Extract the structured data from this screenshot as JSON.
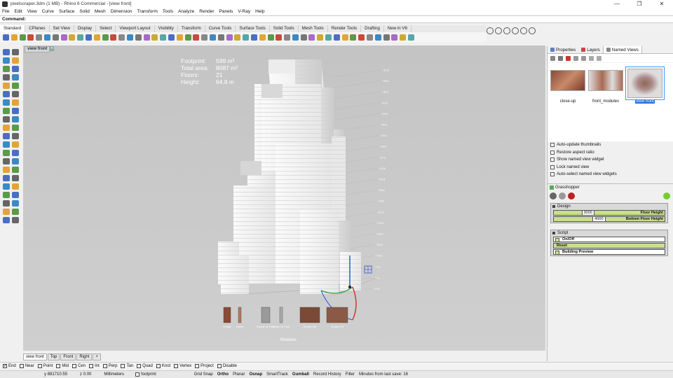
{
  "window": {
    "title": "pixelscraper.3dm (1 MB) - Rhino 6 Commercial - [view front]",
    "controls": [
      "—",
      "❐",
      "✕"
    ]
  },
  "menu": [
    "File",
    "Edit",
    "View",
    "Curve",
    "Surface",
    "Solid",
    "Mesh",
    "Dimension",
    "Transform",
    "Tools",
    "Analyze",
    "Render",
    "Panels",
    "V-Ray",
    "Help"
  ],
  "command": {
    "label": "Command:"
  },
  "toolbar_tabs": [
    "Standard",
    "CPlanes",
    "Set View",
    "Display",
    "Select",
    "Viewport Layout",
    "Visibility",
    "Transform",
    "Curve Tools",
    "Surface Tools",
    "Solid Tools",
    "Mesh Tools",
    "Render Tools",
    "Drafting",
    "New in V6"
  ],
  "viewport": {
    "label": "view front",
    "stats": [
      {
        "key": "Footprint:",
        "value": "599 m²"
      },
      {
        "key": "Total area:",
        "value": "8087 m²"
      },
      {
        "key": "Floors:",
        "value": "21"
      },
      {
        "key": "Height:",
        "value": "64.8 m"
      }
    ],
    "modules_label": "Modules",
    "module_names": [
      "Facade",
      "Corner",
      "Facade No Floor",
      "Corner No Floor",
      "Terrace 180",
      "Terrace 270"
    ],
    "level_labels": [
      "+61.8",
      "+58.8",
      "+55.8",
      "+52.8",
      "+49.8",
      "+46.8",
      "+43.8",
      "+40.8",
      "+37.8",
      "+34.8",
      "+31.8",
      "+28.8",
      "+25.8",
      "+22.8",
      "+19.8",
      "+16.8",
      "+13.8",
      "+10.8",
      "+7.8",
      "+4.8",
      "+1.8"
    ]
  },
  "viewport_tabs": [
    "view front",
    "Top",
    "Front",
    "Right",
    "+"
  ],
  "osnaps": [
    {
      "label": "End",
      "checked": true
    },
    {
      "label": "Near",
      "checked": false
    },
    {
      "label": "Point",
      "checked": false
    },
    {
      "label": "Mid",
      "checked": false
    },
    {
      "label": "Cen",
      "checked": false
    },
    {
      "label": "Int",
      "checked": false
    },
    {
      "label": "Perp",
      "checked": false
    },
    {
      "label": "Tan",
      "checked": false
    },
    {
      "label": "Quad",
      "checked": false
    },
    {
      "label": "Knot",
      "checked": false
    },
    {
      "label": "Vertex",
      "checked": false
    },
    {
      "label": "Project",
      "checked": false
    },
    {
      "label": "Disable",
      "checked": false
    }
  ],
  "status": {
    "coord": "y 881710.55",
    "z": "z 0.00",
    "units": "Millimeters",
    "layer": "footprint",
    "toggles": [
      "Grid Snap",
      "Ortho",
      "Planar",
      "Osnap",
      "SmartTrack",
      "Gumball",
      "Record History",
      "Filter"
    ],
    "bold_toggles": [
      "Ortho",
      "Osnap",
      "Gumball"
    ],
    "message": "Minutes from last save: 16"
  },
  "panel": {
    "tabs": [
      "Properties",
      "Layers",
      "Named Views"
    ],
    "views": [
      {
        "name": "close-up",
        "selected": false
      },
      {
        "name": "front_modules",
        "selected": false
      },
      {
        "name": "view front",
        "selected": true
      }
    ],
    "options": [
      "Auto-update thumbnails",
      "Restore aspect ratio",
      "Show named view widget",
      "Lock named view",
      "Auto-select named view widgets"
    ]
  },
  "grasshopper": {
    "title": "Grasshopper",
    "design_group": "Design",
    "sliders": [
      {
        "value": "3000",
        "label": "Floor Height",
        "fill": 0.25
      },
      {
        "value": "4000",
        "label": "Bottom Floor Height",
        "fill": 0.35
      }
    ],
    "script_group": "Script",
    "buttons": [
      {
        "label": "On/Off",
        "kind": "toggle"
      },
      {
        "label": "Reset",
        "kind": "green"
      },
      {
        "label": "Building Preview",
        "kind": "toggle"
      }
    ]
  },
  "colors": {
    "accent": "#2a6fdc",
    "slider": "#c9e08a",
    "viewport": "#c8c8c8"
  }
}
